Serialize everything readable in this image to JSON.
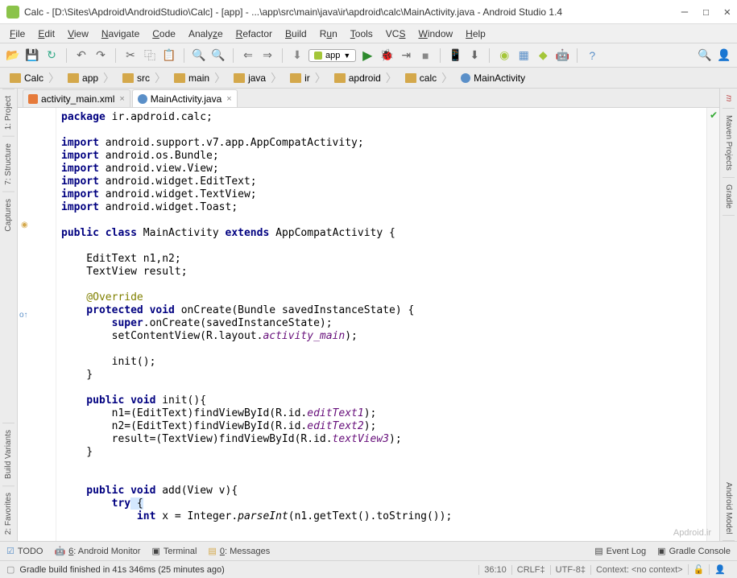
{
  "window": {
    "title": "Calc - [D:\\Sites\\Apdroid\\AndroidStudio\\Calc] - [app] - ...\\app\\src\\main\\java\\ir\\apdroid\\calc\\MainActivity.java - Android Studio 1.4"
  },
  "menu": {
    "file": "File",
    "edit": "Edit",
    "view": "View",
    "navigate": "Navigate",
    "code": "Code",
    "analyze": "Analyze",
    "refactor": "Refactor",
    "build": "Build",
    "run": "Run",
    "tools": "Tools",
    "vcs": "VCS",
    "window": "Window",
    "help": "Help"
  },
  "toolbar": {
    "module": "app"
  },
  "breadcrumb": {
    "items": [
      "Calc",
      "app",
      "src",
      "main",
      "java",
      "ir",
      "apdroid",
      "calc",
      "MainActivity"
    ]
  },
  "tabs": {
    "tab0": "activity_main.xml",
    "tab1": "MainActivity.java"
  },
  "left_panels": {
    "p0": "1: Project",
    "p1": "7: Structure",
    "p2": "Captures",
    "p3": "Build Variants",
    "p4": "2: Favorites"
  },
  "right_panels": {
    "p0": "Maven Projects",
    "p1": "Gradle",
    "p2": "Android Model"
  },
  "bottom_panels": {
    "todo": "TODO",
    "android": "6: Android Monitor",
    "terminal": "Terminal",
    "messages": "0: Messages",
    "eventlog": "Event Log",
    "gradle": "Gradle Console"
  },
  "status": {
    "message": "Gradle build finished in 41s 346ms (25 minutes ago)",
    "position": "36:10",
    "lineend": "CRLF",
    "encoding": "UTF-8",
    "context": "Context: <no context>"
  },
  "watermark": "Apdroid.ir",
  "code": {
    "l1a": "package",
    "l1b": " ir.apdroid.calc;",
    "l3a": "import",
    "l3b": " android.support.v7.app.AppCompatActivity;",
    "l4a": "import",
    "l4b": " android.os.Bundle;",
    "l5a": "import",
    "l5b": " android.view.View;",
    "l6a": "import",
    "l6b": " android.widget.EditText;",
    "l7a": "import",
    "l7b": " android.widget.TextView;",
    "l8a": "import",
    "l8b": " android.widget.Toast;",
    "l10a": "public class",
    "l10b": " MainActivity ",
    "l10c": "extends",
    "l10d": " AppCompatActivity {",
    "l12a": "    EditText n1,n2;",
    "l13a": "    TextView result;",
    "l15a": "    @Override",
    "l16a": "    protected void",
    "l16b": " onCreate(Bundle savedInstanceState) {",
    "l17a": "        super",
    "l17b": ".onCreate(savedInstanceState);",
    "l18a": "        setContentView(R.layout.",
    "l18b": "activity_main",
    "l18c": ");",
    "l20a": "        init();",
    "l21a": "    }",
    "l23a": "    public void",
    "l23b": " init(){",
    "l24a": "        n1=(EditText)findViewById(R.id.",
    "l24b": "editText1",
    "l24c": ");",
    "l25a": "        n2=(EditText)findViewById(R.id.",
    "l25b": "editText2",
    "l25c": ");",
    "l26a": "        result=(TextView)findViewById(R.id.",
    "l26b": "textView3",
    "l26c": ");",
    "l27a": "    }",
    "l30a": "    public void",
    "l30b": " add(View v){",
    "l31a": "        try",
    "l31b": " {",
    "l32a": "            int",
    "l32b": " x = Integer.",
    "l32c": "parseInt",
    "l32d": "(n1.getText().toString());"
  }
}
